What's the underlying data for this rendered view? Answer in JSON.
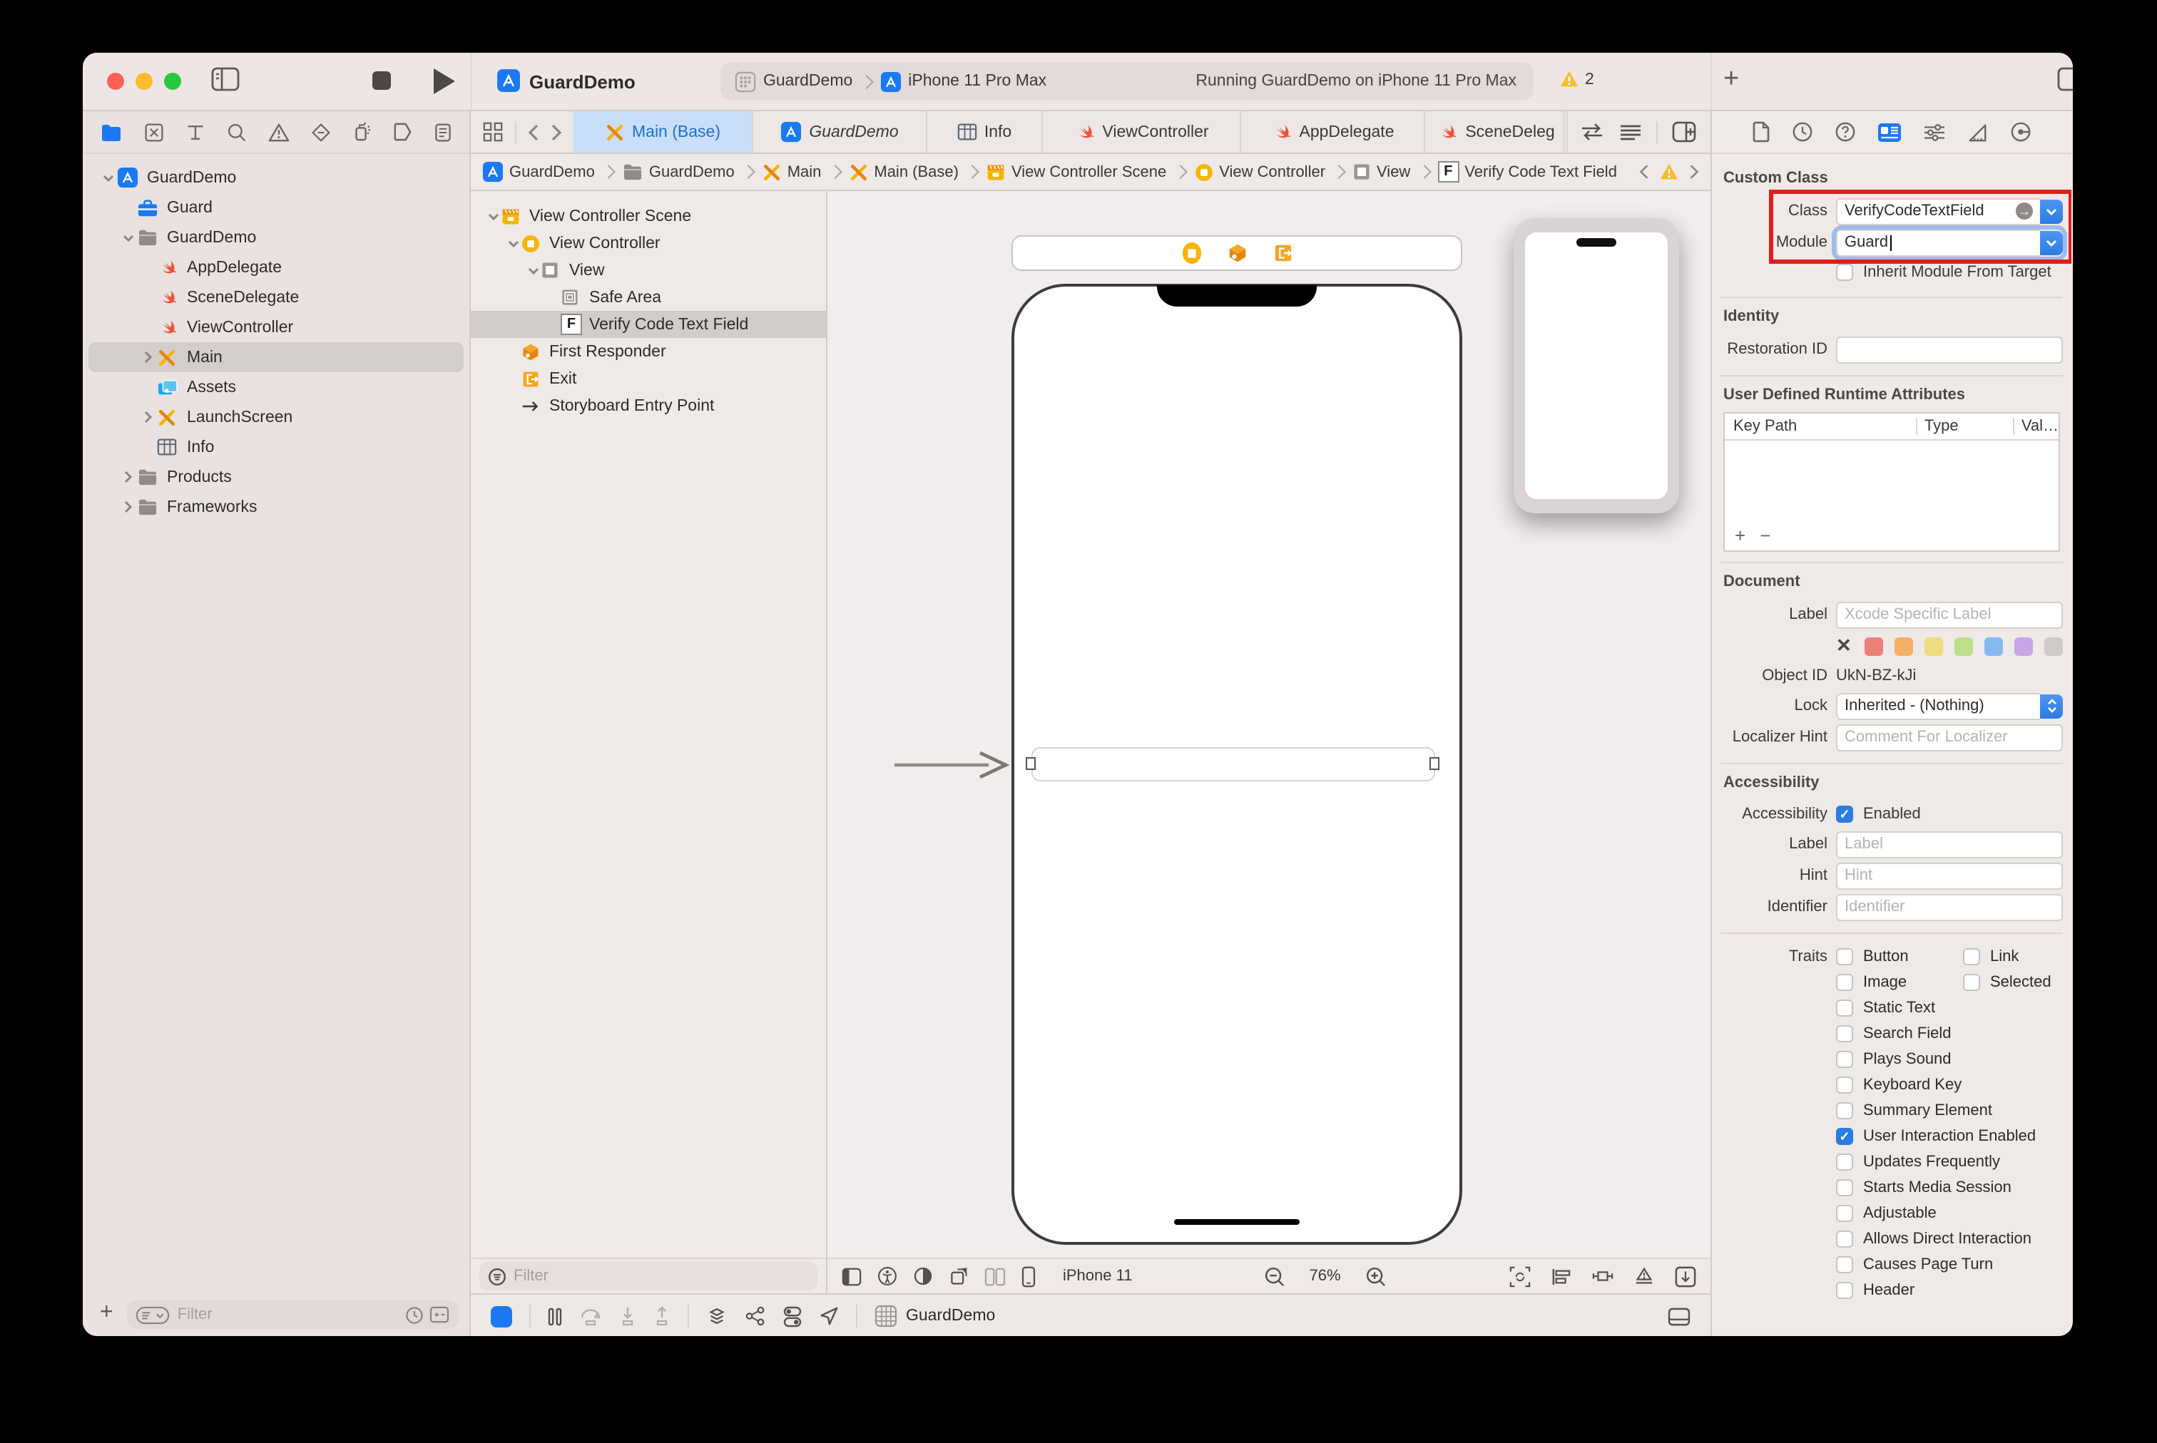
{
  "toolbar": {
    "project_title": "GuardDemo",
    "scheme_target": "GuardDemo",
    "scheme_device": "iPhone 11 Pro Max",
    "status_text": "Running GuardDemo on iPhone 11 Pro Max",
    "warning_count": "2"
  },
  "navigator": {
    "strip_icons": [
      "project-navigator",
      "source-control",
      "symbols",
      "find",
      "issues",
      "tests",
      "debug",
      "breakpoints",
      "reports"
    ],
    "tree": [
      {
        "label": "GuardDemo",
        "icon": "app",
        "indent": 0,
        "chevron": "down"
      },
      {
        "label": "Guard",
        "icon": "toolbox",
        "indent": 1
      },
      {
        "label": "GuardDemo",
        "icon": "folder",
        "indent": 1,
        "chevron": "down"
      },
      {
        "label": "AppDelegate",
        "icon": "swift",
        "indent": 2
      },
      {
        "label": "SceneDelegate",
        "icon": "swift",
        "indent": 2
      },
      {
        "label": "ViewController",
        "icon": "swift",
        "indent": 2
      },
      {
        "label": "Main",
        "icon": "storyboard",
        "indent": 2,
        "chevron": "right",
        "selected": true
      },
      {
        "label": "Assets",
        "icon": "assets",
        "indent": 2
      },
      {
        "label": "LaunchScreen",
        "icon": "storyboard",
        "indent": 2,
        "chevron": "right"
      },
      {
        "label": "Info",
        "icon": "table",
        "indent": 2
      },
      {
        "label": "Products",
        "icon": "folder",
        "indent": 1,
        "chevron": "right"
      },
      {
        "label": "Frameworks",
        "icon": "folder",
        "indent": 1,
        "chevron": "right"
      }
    ],
    "filter_placeholder": "Filter"
  },
  "editor": {
    "tabs": [
      {
        "label": "Main (Base)",
        "icon": "storyboard",
        "active": true
      },
      {
        "label": "GuardDemo",
        "icon": "app",
        "italic": true
      },
      {
        "label": "Info",
        "icon": "table"
      },
      {
        "label": "ViewController",
        "icon": "swift"
      },
      {
        "label": "AppDelegate",
        "icon": "swift"
      },
      {
        "label": "SceneDeleg",
        "icon": "swift",
        "truncated": true
      }
    ],
    "jump_bar": [
      {
        "label": "GuardDemo",
        "icon": "app"
      },
      {
        "label": "GuardDemo",
        "icon": "folder"
      },
      {
        "label": "Main",
        "icon": "storyboard"
      },
      {
        "label": "Main (Base)",
        "icon": "storyboard"
      },
      {
        "label": "View Controller Scene",
        "icon": "clapper"
      },
      {
        "label": "View Controller",
        "icon": "vc"
      },
      {
        "label": "View",
        "icon": "view"
      },
      {
        "label": "Verify Code Text Field",
        "icon": "f"
      }
    ],
    "outline": [
      {
        "label": "View Controller Scene",
        "icon": "clapper",
        "indent": 0,
        "chevron": "down"
      },
      {
        "label": "View Controller",
        "icon": "vc",
        "indent": 1,
        "chevron": "down"
      },
      {
        "label": "View",
        "icon": "view",
        "indent": 2,
        "chevron": "down"
      },
      {
        "label": "Safe Area",
        "icon": "safearea",
        "indent": 3
      },
      {
        "label": "Verify Code Text Field",
        "icon": "f",
        "indent": 3,
        "selected": true
      },
      {
        "label": "First Responder",
        "icon": "cube",
        "indent": 1
      },
      {
        "label": "Exit",
        "icon": "exit",
        "indent": 1
      },
      {
        "label": "Storyboard Entry Point",
        "icon": "arrow",
        "indent": 1
      }
    ],
    "outline_filter_placeholder": "Filter",
    "canvas": {
      "device_label": "iPhone 11",
      "zoom_level": "76%"
    },
    "debug_bar": {
      "app_label": "GuardDemo"
    }
  },
  "inspector": {
    "custom_class": {
      "title": "Custom Class",
      "class_label": "Class",
      "class_value": "VerifyCodeTextField",
      "module_label": "Module",
      "module_value": "Guard",
      "inherit_label": "Inherit Module From Target"
    },
    "identity": {
      "title": "Identity",
      "restoration_label": "Restoration ID"
    },
    "runtime_attributes": {
      "title": "User Defined Runtime Attributes",
      "columns": [
        "Key Path",
        "Type",
        "Val…"
      ]
    },
    "document": {
      "title": "Document",
      "label_label": "Label",
      "label_placeholder": "Xcode Specific Label",
      "swatch_colors": [
        "#ED8077",
        "#F2B266",
        "#EFDC7E",
        "#BCDF8B",
        "#86B8F2",
        "#C9A5E8",
        "#CFCBCA"
      ],
      "object_id_label": "Object ID",
      "object_id_value": "UkN-BZ-kJi",
      "lock_label": "Lock",
      "lock_value": "Inherited - (Nothing)",
      "localizer_label": "Localizer Hint",
      "localizer_placeholder": "Comment For Localizer"
    },
    "accessibility": {
      "title": "Accessibility",
      "enabled_row_label": "Accessibility",
      "enabled_label": "Enabled",
      "enabled_checked": true,
      "label_label": "Label",
      "label_placeholder": "Label",
      "hint_label": "Hint",
      "hint_placeholder": "Hint",
      "identifier_label": "Identifier",
      "identifier_placeholder": "Identifier",
      "traits_label": "Traits",
      "traits": [
        {
          "label": "Button"
        },
        {
          "label": "Link"
        },
        {
          "label": "Image"
        },
        {
          "label": "Selected"
        },
        {
          "label": "Static Text"
        },
        {
          "label": "Search Field"
        },
        {
          "label": "Plays Sound"
        },
        {
          "label": "Keyboard Key"
        },
        {
          "label": "Summary Element"
        },
        {
          "label": "User Interaction Enabled",
          "checked": true
        },
        {
          "label": "Updates Frequently"
        },
        {
          "label": "Starts Media Session"
        },
        {
          "label": "Adjustable"
        },
        {
          "label": "Allows Direct Interaction"
        },
        {
          "label": "Causes Page Turn"
        },
        {
          "label": "Header"
        }
      ]
    }
  },
  "colors": {
    "accent": "#2A7DE1",
    "annotation": "#E01E1E",
    "warning": "#F7BD2E",
    "tab_active": "#C9DEF8"
  }
}
